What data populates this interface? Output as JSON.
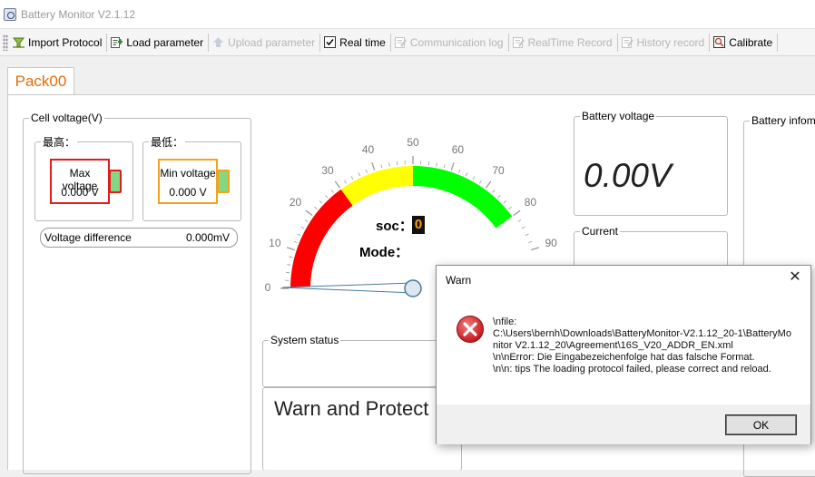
{
  "window": {
    "title": "Battery Monitor V2.1.12"
  },
  "toolbar": {
    "import_protocol": "Import Protocol",
    "load_parameter": "Load parameter",
    "upload_parameter": "Upload parameter",
    "real_time": "Real time",
    "communication_log": "Communication log",
    "realtime_record": "RealTime Record",
    "history_record": "History record",
    "calibrate": "Calibrate"
  },
  "tabs": [
    {
      "label": "Pack00"
    }
  ],
  "cell_voltage": {
    "title": "Cell voltage(V)",
    "highest_label": "最高：",
    "lowest_label": "最低：",
    "max_label": "Max voltage",
    "max_value": "0.000 V",
    "min_label": "Min voltage",
    "min_value": "0.000 V",
    "diff_label": "Voltage difference",
    "diff_value": "0.000mV"
  },
  "gauge": {
    "ticks": [
      "0",
      "10",
      "20",
      "30",
      "40",
      "50",
      "60",
      "70",
      "80",
      "90"
    ],
    "soc_label": "soc：",
    "soc_value": "0",
    "mode_label": "Mode：",
    "colors": {
      "low": "#ff0000",
      "mid": "#ffff00",
      "high": "#00ff00"
    }
  },
  "battery_voltage": {
    "title": "Battery voltage",
    "value": "0.00V"
  },
  "current": {
    "title": "Current"
  },
  "battery_info": {
    "title": "Battery infom"
  },
  "system_status": {
    "title": "System status"
  },
  "warn_protect": {
    "title": "Warn and Protect"
  },
  "dialog": {
    "title": "Warn",
    "close": "✕",
    "message": "\\nfile:\nC:\\Users\\bernh\\Downloads\\BatteryMonitor-V2.1.12_20-1\\BatteryMonitor V2.1.12_20\\Agreement\\16S_V20_ADDR_EN.xml\n\\n\\nError: Die Eingabezeichenfolge hat das falsche Format.\n\\n\\n: tips The loading protocol failed, please correct and reload.",
    "ok": "OK"
  }
}
